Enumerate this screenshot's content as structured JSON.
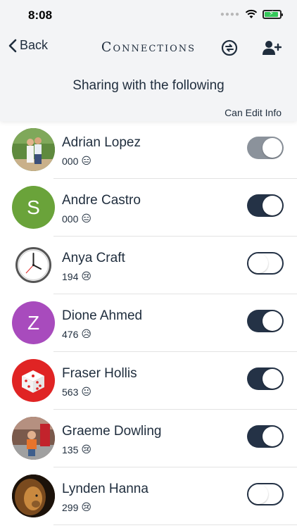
{
  "status_bar": {
    "time": "8:08"
  },
  "nav": {
    "back_label": "Back",
    "title": "Connections"
  },
  "header": {
    "subtitle": "Sharing with the following",
    "column_label": "Can Edit Info"
  },
  "colors": {
    "toggle_on": "#243246",
    "toggle_disabled": "#8b929b",
    "andre": "#6aa33a",
    "dione": "#a84bbd",
    "fraser": "#e02424"
  },
  "connections": [
    {
      "name": "Adrian Lopez",
      "count": "000",
      "emoji": "😑",
      "avatar": "photo-couple",
      "can_edit": true,
      "disabled": true
    },
    {
      "name": "Andre Castro",
      "count": "000",
      "emoji": "😑",
      "avatar_letter": "S",
      "avatar": "letter",
      "can_edit": true,
      "disabled": false
    },
    {
      "name": "Anya Craft",
      "count": "194",
      "emoji": "😢",
      "avatar": "clock-icon",
      "can_edit": false,
      "disabled": false
    },
    {
      "name": "Dione Ahmed",
      "count": "476",
      "emoji": "😥",
      "avatar_letter": "Z",
      "avatar": "letter",
      "can_edit": true,
      "disabled": false
    },
    {
      "name": "Fraser Hollis",
      "count": "563",
      "emoji": "😐",
      "avatar": "dice-icon",
      "can_edit": true,
      "disabled": false
    },
    {
      "name": "Graeme Dowling",
      "count": "135",
      "emoji": "😢",
      "avatar": "photo-child",
      "can_edit": true,
      "disabled": false
    },
    {
      "name": "Lynden Hanna",
      "count": "299",
      "emoji": "😢",
      "avatar": "photo-lion",
      "can_edit": false,
      "disabled": false
    }
  ]
}
